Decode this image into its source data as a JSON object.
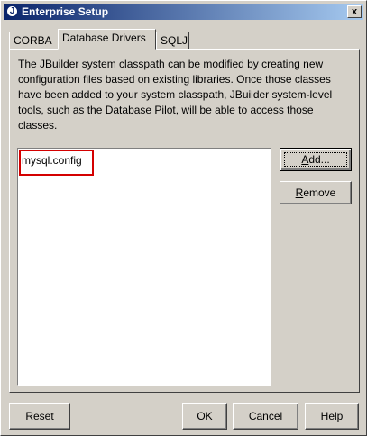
{
  "window": {
    "title": "Enterprise Setup",
    "title_icon": "jbuilder-icon",
    "close_label": "x"
  },
  "tabs": [
    {
      "label": "CORBA",
      "active": false
    },
    {
      "label": "Database Drivers",
      "active": true
    },
    {
      "label": "SQLJ",
      "active": false
    }
  ],
  "panel": {
    "description": "The JBuilder system classpath can be modified by creating new configuration files based on existing libraries.  Once those classes have been added to your system classpath, JBuilder system-level tools, such as the Database Pilot, will be able to access those classes.",
    "list_items": [
      "mysql.config"
    ],
    "add_label_mnemonic": "A",
    "add_label_rest": "dd...",
    "remove_label_mnemonic": "R",
    "remove_label_rest": "emove"
  },
  "footer": {
    "reset_label": "Reset",
    "ok_label": "OK",
    "cancel_label": "Cancel",
    "help_label": "Help"
  },
  "colors": {
    "title_gradient_start": "#0a246a",
    "title_gradient_end": "#a6caf0",
    "highlight_border": "#d40000",
    "dialog_background": "#d4d0c8"
  }
}
